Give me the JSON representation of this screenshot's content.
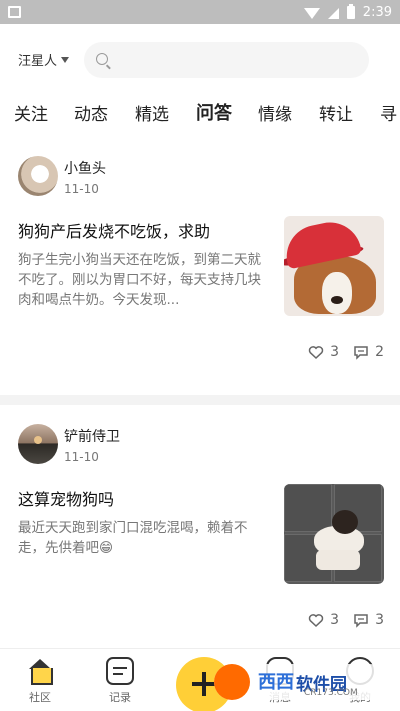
{
  "status_bar": {
    "time": "2:39"
  },
  "header": {
    "location": "汪星人"
  },
  "tabs": [
    {
      "label": "关注"
    },
    {
      "label": "动态"
    },
    {
      "label": "精选"
    },
    {
      "label": "问答"
    },
    {
      "label": "情缘"
    },
    {
      "label": "转让"
    },
    {
      "label": "寻"
    }
  ],
  "posts": [
    {
      "username": "小鱼头",
      "date": "11-10",
      "title": "狗狗产后发烧不吃饭，求助",
      "body": "狗子生完小狗当天还在吃饭，到第二天就不吃了。刚以为胃口不好，每天支持几块肉和喝点牛奶。今天发现...",
      "likes": "3",
      "comments": "2"
    },
    {
      "username": "铲前侍卫",
      "date": "11-10",
      "title": "这算宠物狗吗",
      "body": "最近天天跑到家门口混吃混喝，赖着不走，先供着吧😁",
      "likes": "3",
      "comments": "3"
    }
  ],
  "bottom_nav": [
    {
      "label": "社区"
    },
    {
      "label": "记录"
    },
    {
      "label": "消息"
    },
    {
      "label": "我的"
    }
  ],
  "watermark": {
    "brand_cn": "西西",
    "brand_cn2": "软件园",
    "domain": "CR173.COM"
  },
  "colors": {
    "accent": "#ffcf37",
    "status_bar": "#bdbdbd",
    "text_primary": "#222222",
    "text_secondary": "#777777"
  }
}
